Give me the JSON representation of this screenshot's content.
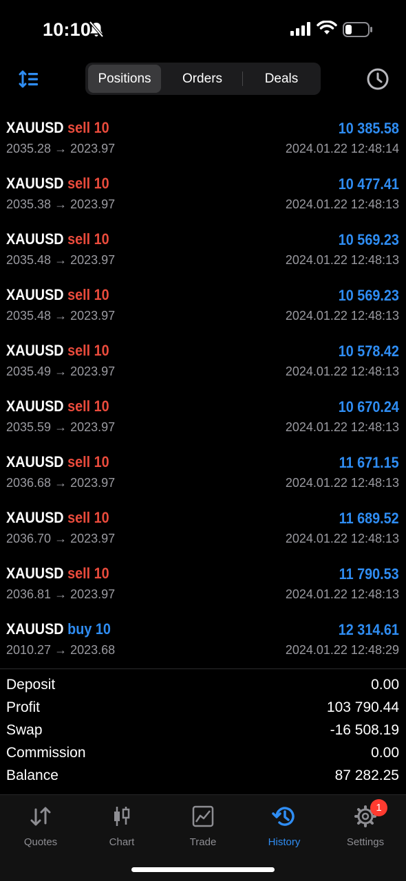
{
  "status_bar": {
    "time": "10:10"
  },
  "toolbar": {
    "tabs": [
      {
        "label": "Positions",
        "active": true
      },
      {
        "label": "Orders",
        "active": false
      },
      {
        "label": "Deals",
        "active": false
      }
    ]
  },
  "deals": [
    {
      "symbol": "XAUUSD",
      "side": "sell",
      "volume": "sell 10",
      "prices": "2035.28 → 2023.97",
      "profit": "10 385.58",
      "date": "2024.01.22 12:48:14"
    },
    {
      "symbol": "XAUUSD",
      "side": "sell",
      "volume": "sell 10",
      "prices": "2035.38 → 2023.97",
      "profit": "10 477.41",
      "date": "2024.01.22 12:48:13"
    },
    {
      "symbol": "XAUUSD",
      "side": "sell",
      "volume": "sell 10",
      "prices": "2035.48 → 2023.97",
      "profit": "10 569.23",
      "date": "2024.01.22 12:48:13"
    },
    {
      "symbol": "XAUUSD",
      "side": "sell",
      "volume": "sell 10",
      "prices": "2035.48 → 2023.97",
      "profit": "10 569.23",
      "date": "2024.01.22 12:48:13"
    },
    {
      "symbol": "XAUUSD",
      "side": "sell",
      "volume": "sell 10",
      "prices": "2035.49 → 2023.97",
      "profit": "10 578.42",
      "date": "2024.01.22 12:48:13"
    },
    {
      "symbol": "XAUUSD",
      "side": "sell",
      "volume": "sell 10",
      "prices": "2035.59 → 2023.97",
      "profit": "10 670.24",
      "date": "2024.01.22 12:48:13"
    },
    {
      "symbol": "XAUUSD",
      "side": "sell",
      "volume": "sell 10",
      "prices": "2036.68 → 2023.97",
      "profit": "11 671.15",
      "date": "2024.01.22 12:48:13"
    },
    {
      "symbol": "XAUUSD",
      "side": "sell",
      "volume": "sell 10",
      "prices": "2036.70 → 2023.97",
      "profit": "11 689.52",
      "date": "2024.01.22 12:48:13"
    },
    {
      "symbol": "XAUUSD",
      "side": "sell",
      "volume": "sell 10",
      "prices": "2036.81 → 2023.97",
      "profit": "11 790.53",
      "date": "2024.01.22 12:48:13"
    },
    {
      "symbol": "XAUUSD",
      "side": "buy",
      "volume": "buy 10",
      "prices": "2010.27 → 2023.68",
      "profit": "12 314.61",
      "date": "2024.01.22 12:48:29"
    }
  ],
  "summary": [
    {
      "label": "Deposit",
      "value": "0.00"
    },
    {
      "label": "Profit",
      "value": "103 790.44"
    },
    {
      "label": "Swap",
      "value": "-16 508.19"
    },
    {
      "label": "Commission",
      "value": "0.00"
    },
    {
      "label": "Balance",
      "value": "87 282.25"
    }
  ],
  "tabbar": {
    "items": [
      {
        "label": "Quotes",
        "icon": "quotes-arrows-icon",
        "active": false
      },
      {
        "label": "Chart",
        "icon": "candlestick-chart-icon",
        "active": false
      },
      {
        "label": "Trade",
        "icon": "trade-chart-icon",
        "active": false
      },
      {
        "label": "History",
        "icon": "history-clock-icon",
        "active": true
      },
      {
        "label": "Settings",
        "icon": "gear-icon",
        "active": false,
        "badge": "1"
      }
    ]
  },
  "colors": {
    "accent": "#2f8df3",
    "sell": "#ea4b3c",
    "background": "#000000"
  }
}
